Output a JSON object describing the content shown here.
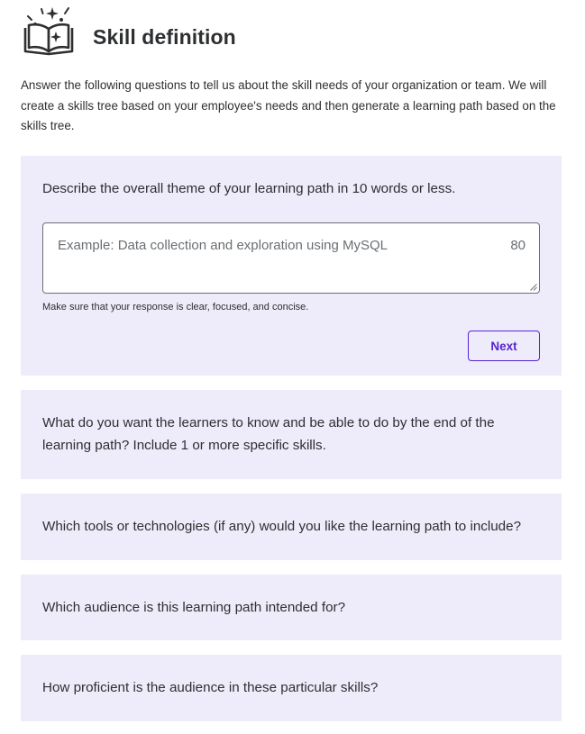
{
  "header": {
    "title": "Skill definition",
    "icon": "open-book-sparkle-icon"
  },
  "intro": {
    "text": "Answer the following questions to tell us about the skill needs of your organization or team. We will create a skills tree based on your employee's needs and then generate a learning path based on the skills tree."
  },
  "colors": {
    "accent": "#5624d0",
    "card_background": "#eeecfa",
    "text": "#2d2f31",
    "muted_text": "#6a6f73"
  },
  "questions": [
    {
      "prompt": "Describe the overall theme of your learning path in 10 words or less.",
      "input": {
        "value": "",
        "placeholder": "Example: Data collection and exploration using MySQL",
        "char_count": "80"
      },
      "helper": "Make sure that your response is clear, focused, and concise.",
      "next_label": "Next"
    },
    {
      "prompt": "What do you want the learners to know and be able to do by the end of the learning path? Include 1 or more specific skills."
    },
    {
      "prompt": "Which tools or technologies (if any) would you like the learning path to include?"
    },
    {
      "prompt": "Which audience is this learning path intended for?"
    },
    {
      "prompt": "How proficient is the audience in these particular skills?"
    }
  ]
}
